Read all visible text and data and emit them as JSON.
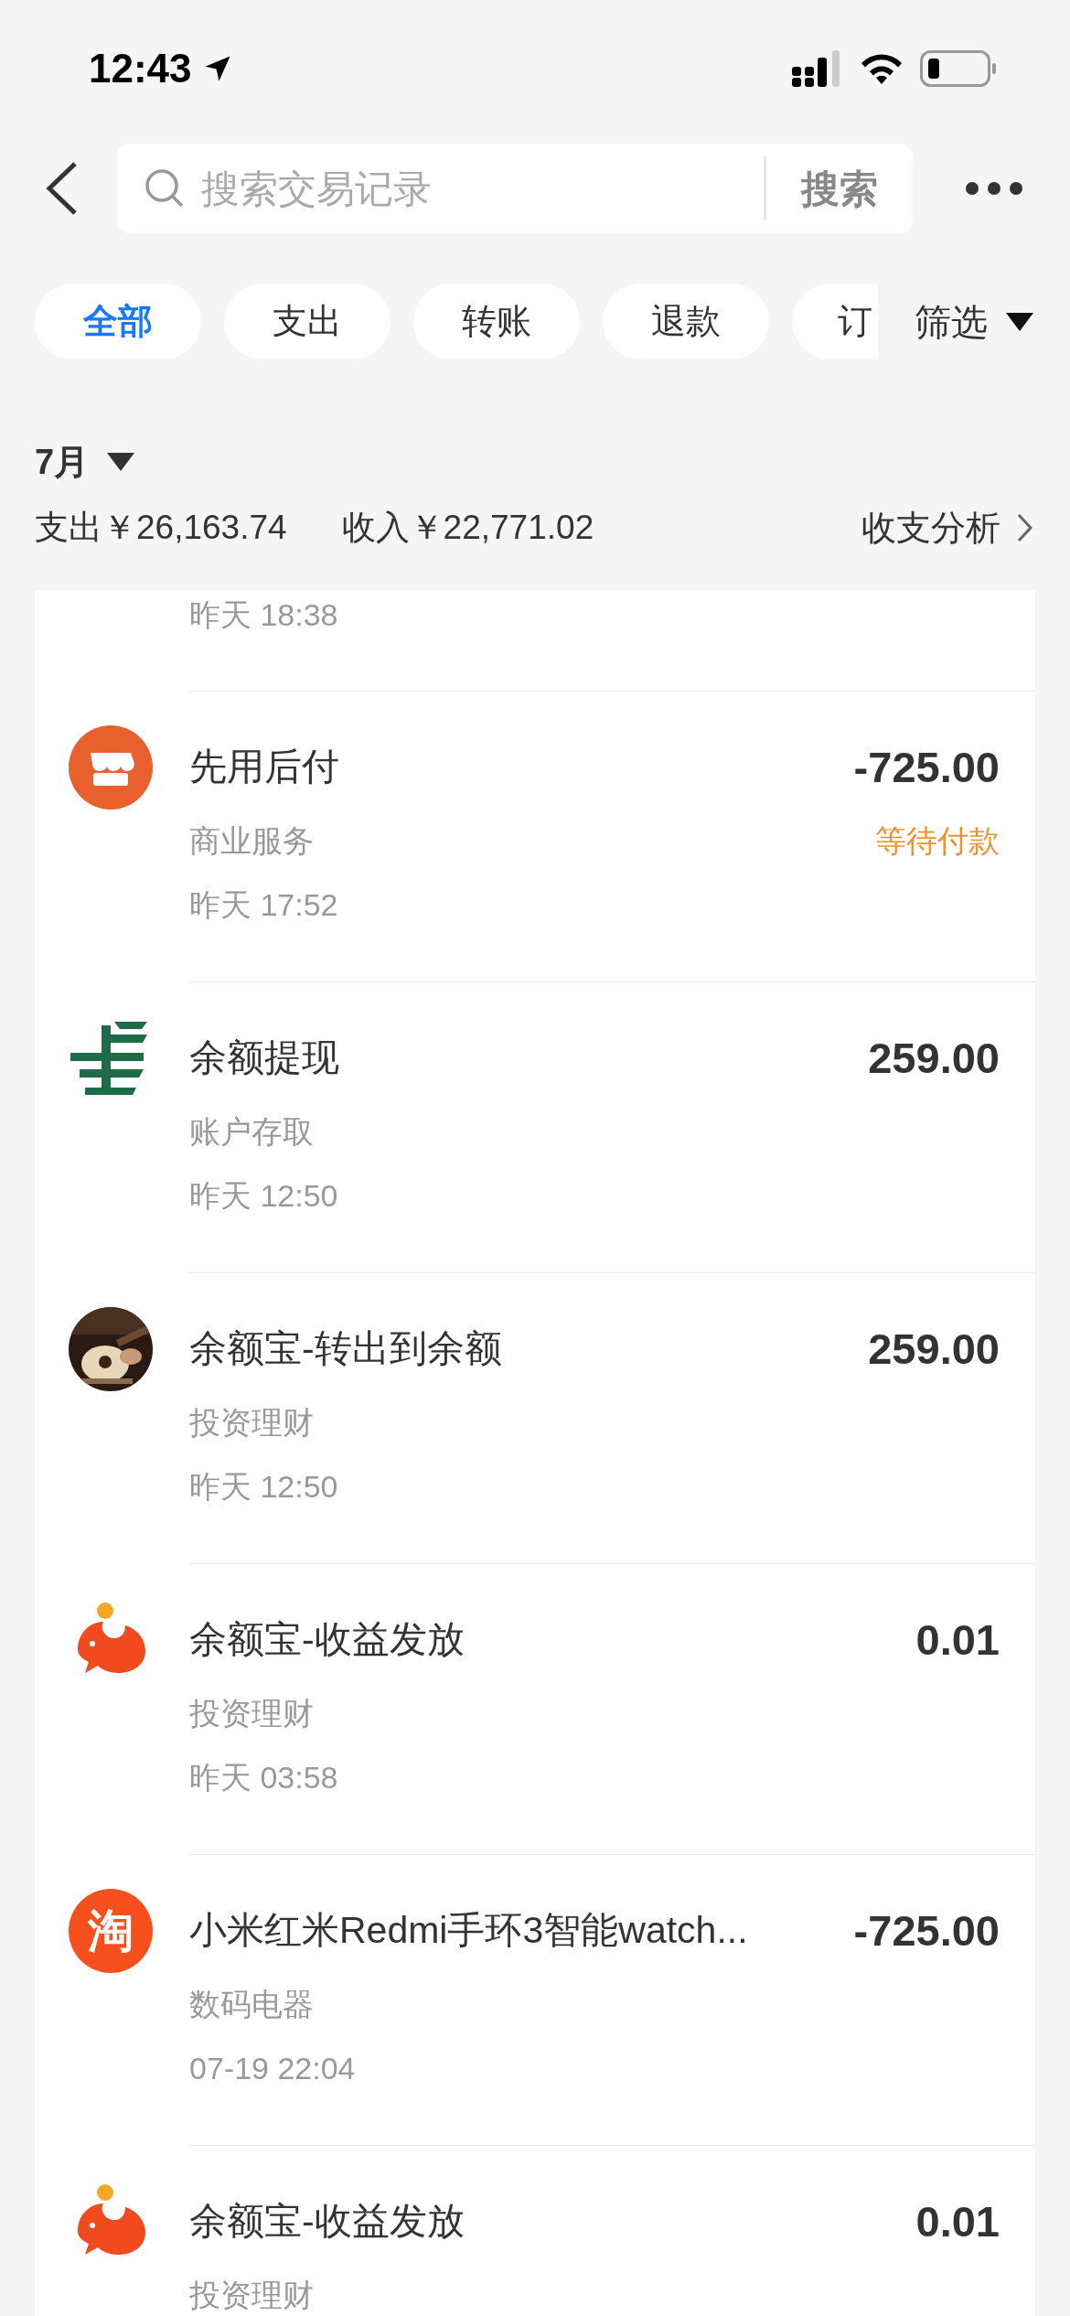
{
  "status_bar": {
    "time": "12:43"
  },
  "search": {
    "placeholder": "搜索交易记录",
    "button": "搜索"
  },
  "chips": [
    {
      "label": "全部",
      "selected": true
    },
    {
      "label": "支出",
      "selected": false
    },
    {
      "label": "转账",
      "selected": false
    },
    {
      "label": "退款",
      "selected": false
    },
    {
      "label": "订",
      "selected": false
    }
  ],
  "filter": {
    "label": "筛选"
  },
  "month": "7月",
  "summary": {
    "expense": "支出￥26,163.74",
    "income": "收入￥22,771.02",
    "analysis": "收支分析"
  },
  "partial_row": {
    "time": "昨天 18:38"
  },
  "transactions": [
    {
      "kind": "store",
      "title": "先用后付",
      "category": "商业服务",
      "time": "昨天 17:52",
      "amount": "-725.00",
      "status": "等待付款"
    },
    {
      "kind": "postal",
      "title": "余额提现",
      "category": "账户存取",
      "time": "昨天 12:50",
      "amount": "259.00"
    },
    {
      "title": "余额宝-转出到余额",
      "category": "投资理财",
      "time": "昨天 12:50",
      "amount": "259.00"
    },
    {
      "kind": "fund",
      "title": "余额宝-收益发放",
      "category": "投资理财",
      "time": "昨天 03:58",
      "amount": "0.01"
    },
    {
      "kind": "shop",
      "icon_text": "淘",
      "title": "小米红米Redmi手环3智能watch...",
      "category": "数码电器",
      "time": "07-19 22:04",
      "amount": "-725.00"
    },
    {
      "kind": "fund",
      "title": "余额宝-收益发放",
      "category": "投资理财",
      "amount": "0.01"
    }
  ]
}
